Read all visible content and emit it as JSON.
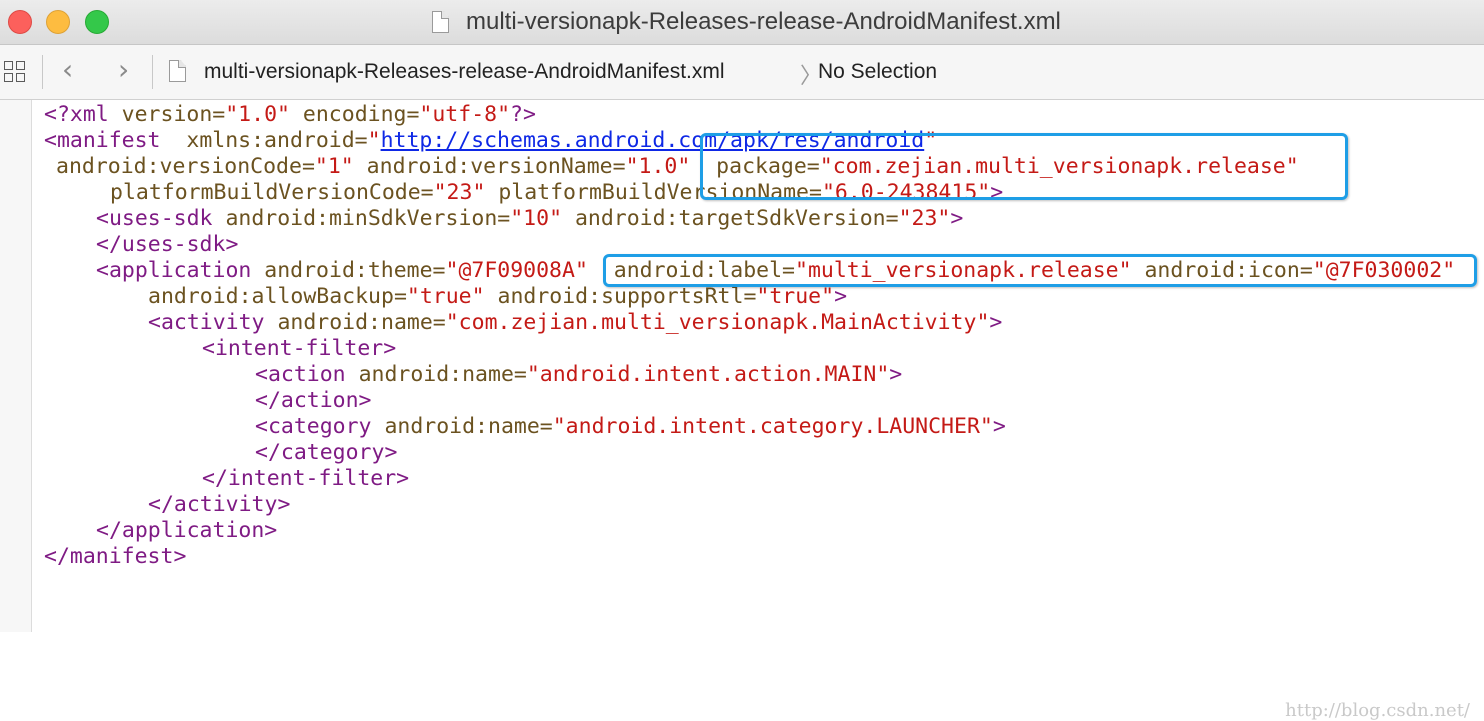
{
  "window": {
    "title": "multi-versionapk-Releases-release-AndroidManifest.xml"
  },
  "jumpbar": {
    "file_name": "multi-versionapk-Releases-release-AndroidManifest.xml",
    "selection": "No Selection",
    "back_icon": "chevron-left",
    "forward_icon": "chevron-right",
    "related_items_icon": "grid-icon"
  },
  "editor": {
    "lines": [
      [
        [
          "p",
          "<?xml "
        ],
        [
          "a",
          "version="
        ],
        [
          "v",
          "\"1.0\""
        ],
        [
          "p",
          " "
        ],
        [
          "a",
          "encoding="
        ],
        [
          "v",
          "\"utf-8\""
        ],
        [
          "p",
          "?>"
        ]
      ],
      [
        [
          "p",
          "<manifest  "
        ],
        [
          "a",
          "xmlns:android="
        ],
        [
          "v",
          "\""
        ],
        [
          "u",
          "http://schemas.android.com/apk/res/android"
        ],
        [
          "v",
          "\""
        ]
      ],
      [
        [
          "a",
          "android:versionCode="
        ],
        [
          "v",
          "\"1\""
        ],
        [
          "a",
          " android:versionName="
        ],
        [
          "v",
          "\"1.0\""
        ],
        [
          "a",
          "  package="
        ],
        [
          "v",
          "\"com.zejian.multi_versionapk.release\""
        ]
      ],
      [
        [
          "a",
          "platformBuildVersionCode="
        ],
        [
          "v",
          "\"23\""
        ],
        [
          "a",
          " platformBuildVersionName="
        ],
        [
          "v",
          "\"6.0-2438415\""
        ],
        [
          "p",
          ">"
        ]
      ],
      [
        [
          "p",
          "<uses-sdk "
        ],
        [
          "a",
          "android:minSdkVersion="
        ],
        [
          "v",
          "\"10\""
        ],
        [
          "a",
          " android:targetSdkVersion="
        ],
        [
          "v",
          "\"23\""
        ],
        [
          "p",
          ">"
        ]
      ],
      [
        [
          "p",
          "</uses-sdk>"
        ]
      ],
      [
        [
          "p",
          "<application "
        ],
        [
          "a",
          "android:theme="
        ],
        [
          "v",
          "\"@7F09008A\""
        ],
        [
          "a",
          "  android:label="
        ],
        [
          "v",
          "\"multi_versionapk.release\""
        ],
        [
          "a",
          " android:icon="
        ],
        [
          "v",
          "\"@7F030002\""
        ]
      ],
      [
        [
          "a",
          "android:allowBackup="
        ],
        [
          "v",
          "\"true\""
        ],
        [
          "a",
          " android:supportsRtl="
        ],
        [
          "v",
          "\"true\""
        ],
        [
          "p",
          ">"
        ]
      ],
      [
        [
          "p",
          "<activity "
        ],
        [
          "a",
          "android:name="
        ],
        [
          "v",
          "\"com.zejian.multi_versionapk.MainActivity\""
        ],
        [
          "p",
          ">"
        ]
      ],
      [
        [
          "p",
          "<intent-filter>"
        ]
      ],
      [
        [
          "p",
          "<action "
        ],
        [
          "a",
          "android:name="
        ],
        [
          "v",
          "\"android.intent.action.MAIN\""
        ],
        [
          "p",
          ">"
        ]
      ],
      [
        [
          "p",
          "</action>"
        ]
      ],
      [
        [
          "p",
          "<category "
        ],
        [
          "a",
          "android:name="
        ],
        [
          "v",
          "\"android.intent.category.LAUNCHER\""
        ],
        [
          "p",
          ">"
        ]
      ],
      [
        [
          "p",
          "</category>"
        ]
      ],
      [
        [
          "p",
          "</intent-filter>"
        ]
      ],
      [
        [
          "p",
          "</activity>"
        ]
      ],
      [
        [
          "p",
          "</application>"
        ]
      ],
      [
        [
          "p",
          "</manifest>"
        ]
      ]
    ]
  },
  "highlight_color": "#1e9ee6",
  "watermark": "http://blog.csdn.net/"
}
